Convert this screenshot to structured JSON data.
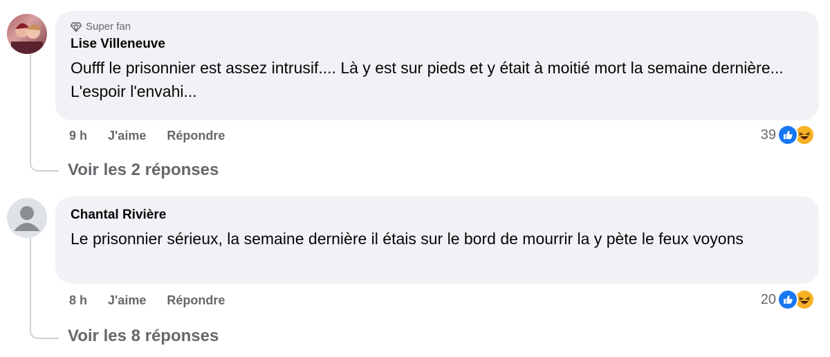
{
  "comments": [
    {
      "badge": "Super fan",
      "author": "Lise Villeneuve",
      "text": "Oufff le prisonnier est assez intrusif.... Là y est sur pieds et y était à moitié mort la semaine dernière... L'espoir l'envahi...",
      "time": "9 h",
      "like_label": "J'aime",
      "reply_label": "Répondre",
      "reaction_count": "39",
      "view_replies": "Voir les 2 réponses"
    },
    {
      "author": "Chantal Rivière",
      "text": "Le prisonnier sérieux, la semaine dernière il étais sur le bord de mourrir la y pète le feux voyons",
      "time": "8 h",
      "like_label": "J'aime",
      "reply_label": "Répondre",
      "reaction_count": "20",
      "view_replies": "Voir les 8 réponses"
    }
  ],
  "icons": {
    "badge": "diamond-icon",
    "like": "thumbs-up-icon",
    "haha": "laughing-face-icon"
  },
  "colors": {
    "bubble": "#f0f2f5",
    "secondary_text": "#65676b",
    "like_blue": "#1877f2",
    "haha_yellow": "#f7b125"
  }
}
